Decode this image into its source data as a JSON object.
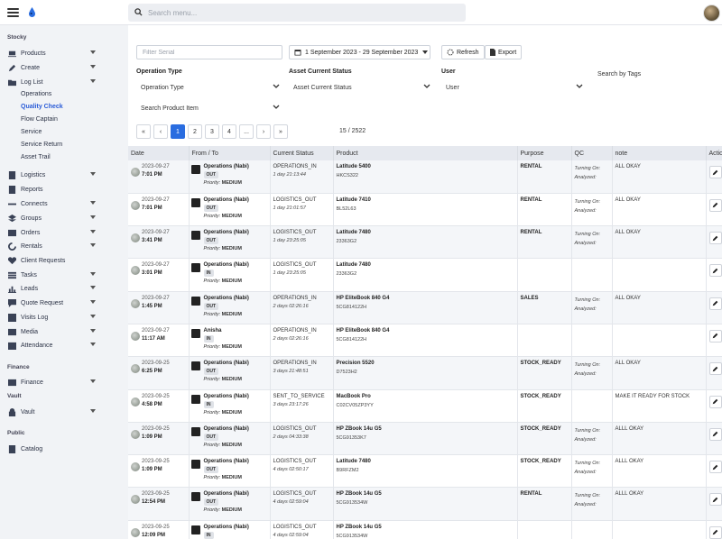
{
  "header": {
    "search_placeholder": "Search menu..."
  },
  "sidebar": {
    "sections": [
      "Stocky",
      "Finance",
      "Vault",
      "Public"
    ],
    "items": [
      {
        "label": "Products",
        "icon": "laptop-icon",
        "caret": true
      },
      {
        "label": "Create",
        "icon": "pencil-icon",
        "caret": true
      },
      {
        "label": "Log List",
        "icon": "folder-icon",
        "caret": true
      },
      {
        "label": "Logistics",
        "icon": "calculator-icon",
        "caret": true
      },
      {
        "label": "Reports",
        "icon": "report-icon",
        "caret": false
      },
      {
        "label": "Connects",
        "icon": "link-icon",
        "caret": true
      },
      {
        "label": "Groups",
        "icon": "layers-icon",
        "caret": true
      },
      {
        "label": "Orders",
        "icon": "orders-icon",
        "caret": true
      },
      {
        "label": "Rentals",
        "icon": "refresh-icon",
        "caret": true
      },
      {
        "label": "Client Requests",
        "icon": "heart-icon",
        "caret": false
      },
      {
        "label": "Tasks",
        "icon": "tasks-icon",
        "caret": true
      },
      {
        "label": "Leads",
        "icon": "chart-icon",
        "caret": true
      },
      {
        "label": "Quote Request",
        "icon": "quote-icon",
        "caret": true
      },
      {
        "label": "Visits Log",
        "icon": "visits-icon",
        "caret": true
      },
      {
        "label": "Media",
        "icon": "media-icon",
        "caret": true
      },
      {
        "label": "Attendance",
        "icon": "calendar-icon",
        "caret": true
      },
      {
        "label": "Finance",
        "icon": "finance-icon",
        "caret": true
      },
      {
        "label": "Vault",
        "icon": "lock-icon",
        "caret": true
      },
      {
        "label": "Catalog",
        "icon": "book-icon",
        "caret": false
      }
    ],
    "sub_items": [
      "Operations",
      "Quality Check",
      "Flow Captain",
      "Service",
      "Service Return",
      "Asset Trail"
    ]
  },
  "filters": {
    "serial_placeholder": "Filter Serial",
    "date_range": "1 September 2023 - 29 September 2023",
    "refresh_label": "Refresh",
    "export_label": "Export",
    "operation_type_label": "Operation Type",
    "operation_type_value": "Operation Type",
    "asset_status_label": "Asset Current Status",
    "asset_status_value": "Asset Current Status",
    "user_label": "User",
    "user_value": "User",
    "tags_label": "Search by Tags",
    "product_item_value": "Search Product Item"
  },
  "pagination": {
    "buttons": [
      "«",
      "‹",
      "1",
      "2",
      "3",
      "4",
      "...",
      "›",
      "»"
    ],
    "active": "1",
    "count": "15 / 2522"
  },
  "table": {
    "headers": [
      "Date",
      "From / To",
      "Current Status",
      "Product",
      "Purpose",
      "QC",
      "note",
      "Actions"
    ],
    "rows": [
      {
        "date": "2023-09-27",
        "time": "7:01 PM",
        "from": "Operations (Nabi)",
        "dir": "OUT",
        "priority": "MEDIUM",
        "status": "OPERATIONS_IN",
        "ago": "1 day 21:13:44",
        "product": "Latitude 5400",
        "serial": "HKCS322",
        "purpose": "RENTAL",
        "qc1": "Turning On:",
        "qc2": "Analyzed:",
        "note": "ALL OKAY"
      },
      {
        "date": "2023-09-27",
        "time": "7:01 PM",
        "from": "Operations (Nabi)",
        "dir": "OUT",
        "priority": "MEDIUM",
        "status": "LOGISTICS_OUT",
        "ago": "1 day 21:01:57",
        "product": "Latitude 7410",
        "serial": "BL52L63",
        "purpose": "RENTAL",
        "qc1": "Turning On:",
        "qc2": "Analyzed:",
        "note": "ALL OKAY"
      },
      {
        "date": "2023-09-27",
        "time": "3:41 PM",
        "from": "Operations (Nabi)",
        "dir": "OUT",
        "priority": "MEDIUM",
        "status": "LOGISTICS_OUT",
        "ago": "1 day 23:25:05",
        "product": "Latitude 7480",
        "serial": "23363G2",
        "purpose": "RENTAL",
        "qc1": "Turning On:",
        "qc2": "Analyzed:",
        "note": "ALL OKAY"
      },
      {
        "date": "2023-09-27",
        "time": "3:01 PM",
        "from": "Operations (Nabi)",
        "dir": "IN",
        "priority": "MEDIUM",
        "status": "LOGISTICS_OUT",
        "ago": "1 day 23:25:05",
        "product": "Latitude 7480",
        "serial": "23363G2",
        "purpose": "",
        "qc1": "",
        "qc2": "",
        "note": ""
      },
      {
        "date": "2023-09-27",
        "time": "1:45 PM",
        "from": "Operations (Nabi)",
        "dir": "OUT",
        "priority": "MEDIUM",
        "status": "OPERATIONS_IN",
        "ago": "2 days 02:26:16",
        "product": "HP EliteBook 840 G4",
        "serial": "5CG814122H",
        "purpose": "SALES",
        "qc1": "Turning On:",
        "qc2": "Analyzed:",
        "note": "ALL OKAY"
      },
      {
        "date": "2023-09-27",
        "time": "11:17 AM",
        "from": "Anisha",
        "dir": "IN",
        "priority": "MEDIUM",
        "status": "OPERATIONS_IN",
        "ago": "2 days 02:26:16",
        "product": "HP EliteBook 840 G4",
        "serial": "5CG814122H",
        "purpose": "",
        "qc1": "",
        "qc2": "",
        "note": ""
      },
      {
        "date": "2023-09-25",
        "time": "6:25 PM",
        "from": "Operations (Nabi)",
        "dir": "OUT",
        "priority": "MEDIUM",
        "status": "OPERATIONS_IN",
        "ago": "3 days 21:48:51",
        "product": "Precision 5520",
        "serial": "D7523H2",
        "purpose": "STOCK_READY",
        "qc1": "Turning On:",
        "qc2": "Analyzed:",
        "note": "ALL OKAY"
      },
      {
        "date": "2023-09-25",
        "time": "4:58 PM",
        "from": "Operations (Nabi)",
        "dir": "IN",
        "priority": "MEDIUM",
        "status": "SENT_TO_SERVICE",
        "ago": "3 days 23:17:26",
        "product": "MacBook Pro",
        "serial": "C02CV05ZP3YY",
        "purpose": "STOCK_READY",
        "qc1": "",
        "qc2": "",
        "note": "MAKE IT READY FOR STOCK"
      },
      {
        "date": "2023-09-25",
        "time": "1:09 PM",
        "from": "Operations (Nabi)",
        "dir": "OUT",
        "priority": "MEDIUM",
        "status": "LOGISTICS_OUT",
        "ago": "2 days 04:33:38",
        "product": "HP ZBook 14u G5",
        "serial": "5CG91353K7",
        "purpose": "STOCK_READY",
        "qc1": "Turning On:",
        "qc2": "Analyzed:",
        "note": "ALLL OKAY"
      },
      {
        "date": "2023-09-25",
        "time": "1:09 PM",
        "from": "Operations (Nabi)",
        "dir": "OUT",
        "priority": "MEDIUM",
        "status": "LOGISTICS_OUT",
        "ago": "4 days 02:50:17",
        "product": "Latitude 7480",
        "serial": "B9RFZM2",
        "purpose": "STOCK_READY",
        "qc1": "Turning On:",
        "qc2": "Analyzed:",
        "note": "ALLL OKAY"
      },
      {
        "date": "2023-09-25",
        "time": "12:54 PM",
        "from": "Operations (Nabi)",
        "dir": "OUT",
        "priority": "MEDIUM",
        "status": "LOGISTICS_OUT",
        "ago": "4 days 02:59:04",
        "product": "HP ZBook 14u G5",
        "serial": "5CG913534W",
        "purpose": "RENTAL",
        "qc1": "Turning On:",
        "qc2": "Analyzed:",
        "note": "ALLL OKAY"
      },
      {
        "date": "2023-09-25",
        "time": "12:09 PM",
        "from": "Operations (Nabi)",
        "dir": "IN",
        "priority": "MEDIUM",
        "status": "LOGISTICS_OUT",
        "ago": "4 days 02:59:04",
        "product": "HP ZBook 14u G5",
        "serial": "5CG913534W",
        "purpose": "",
        "qc1": "",
        "qc2": "",
        "note": ""
      }
    ]
  }
}
